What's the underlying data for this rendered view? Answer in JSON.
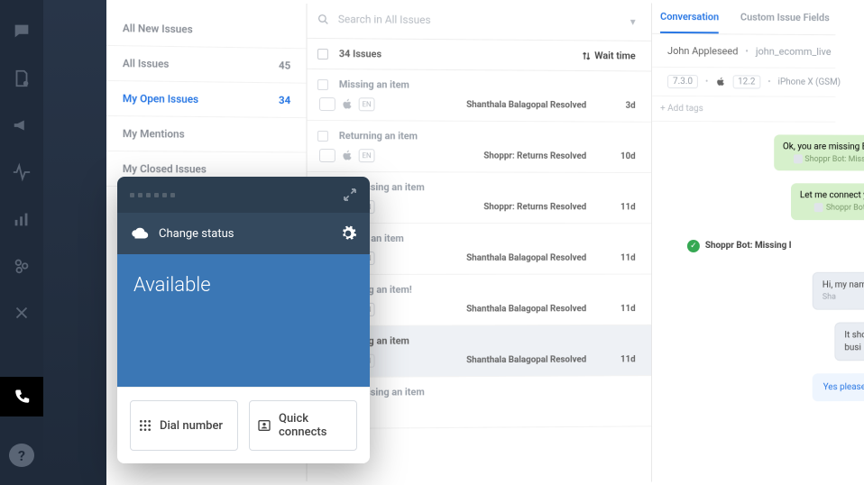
{
  "filters": {
    "all_new": "All New Issues",
    "all": "All Issues",
    "all_count": "45",
    "my_open": "My Open Issues",
    "my_open_count": "34",
    "mentions": "My Mentions",
    "closed": "My Closed Issues"
  },
  "search": {
    "placeholder": "Search in All Issues"
  },
  "list_header": {
    "count_label": "34 Issues",
    "sort_label": "Wait time"
  },
  "issues": [
    {
      "title": "Missing an item",
      "brand": "apple",
      "lang": "EN",
      "resolver": "Shanthala Balagopal Resolved",
      "age": "3d"
    },
    {
      "title": "Returning an item",
      "brand": "apple",
      "lang": "EN",
      "resolver": "Shoppr: Returns Resolved",
      "age": "10d"
    },
    {
      "title": "I'm missing an item",
      "brand": "apple",
      "lang": "EN",
      "resolver": "Shoppr: Returns Resolved",
      "age": "11d"
    },
    {
      "title": "Return an item",
      "brand": "apple",
      "lang": "EN",
      "resolver": "Shanthala Balagopal Resolved",
      "age": "11d"
    },
    {
      "title": "missing an item!",
      "brand": "square",
      "lang": "EN",
      "resolver": "Shanthala Balagopal Resolved",
      "age": "11d"
    },
    {
      "title": "Missing an item",
      "brand": "apple",
      "lang": "EN",
      "resolver": "Shanthala Balagopal Resolved",
      "age": "11d",
      "selected": true
    },
    {
      "title": "I'm missing an item",
      "brand": "",
      "lang": "",
      "resolver": "",
      "age": ""
    }
  ],
  "conv": {
    "tab1": "Conversation",
    "tab2": "Custom Issue Fields",
    "user_name": "John Appleseed",
    "user_handle": "john_ecomm_live",
    "app_ver": "7.3.0",
    "os_ver": "12.2",
    "device": "iPhone X (GSM)",
    "add_tags": "+  Add tags",
    "bot1": "Ok, you are missing B",
    "bot1_sub": "Shoppr Bot: Missi",
    "bot2": "Let me connect y",
    "bot2_sub": "Shoppr Bot:",
    "sys": "Shoppr Bot: Missing I",
    "u1": "Hi, my nam",
    "u1_sub": "Sha",
    "u2": "It sho",
    "u2b": "busi",
    "u3": "Yes please"
  },
  "dialer": {
    "change_status": "Change status",
    "state": "Available",
    "dial_label": "Dial number",
    "quick_label": "Quick connects"
  }
}
